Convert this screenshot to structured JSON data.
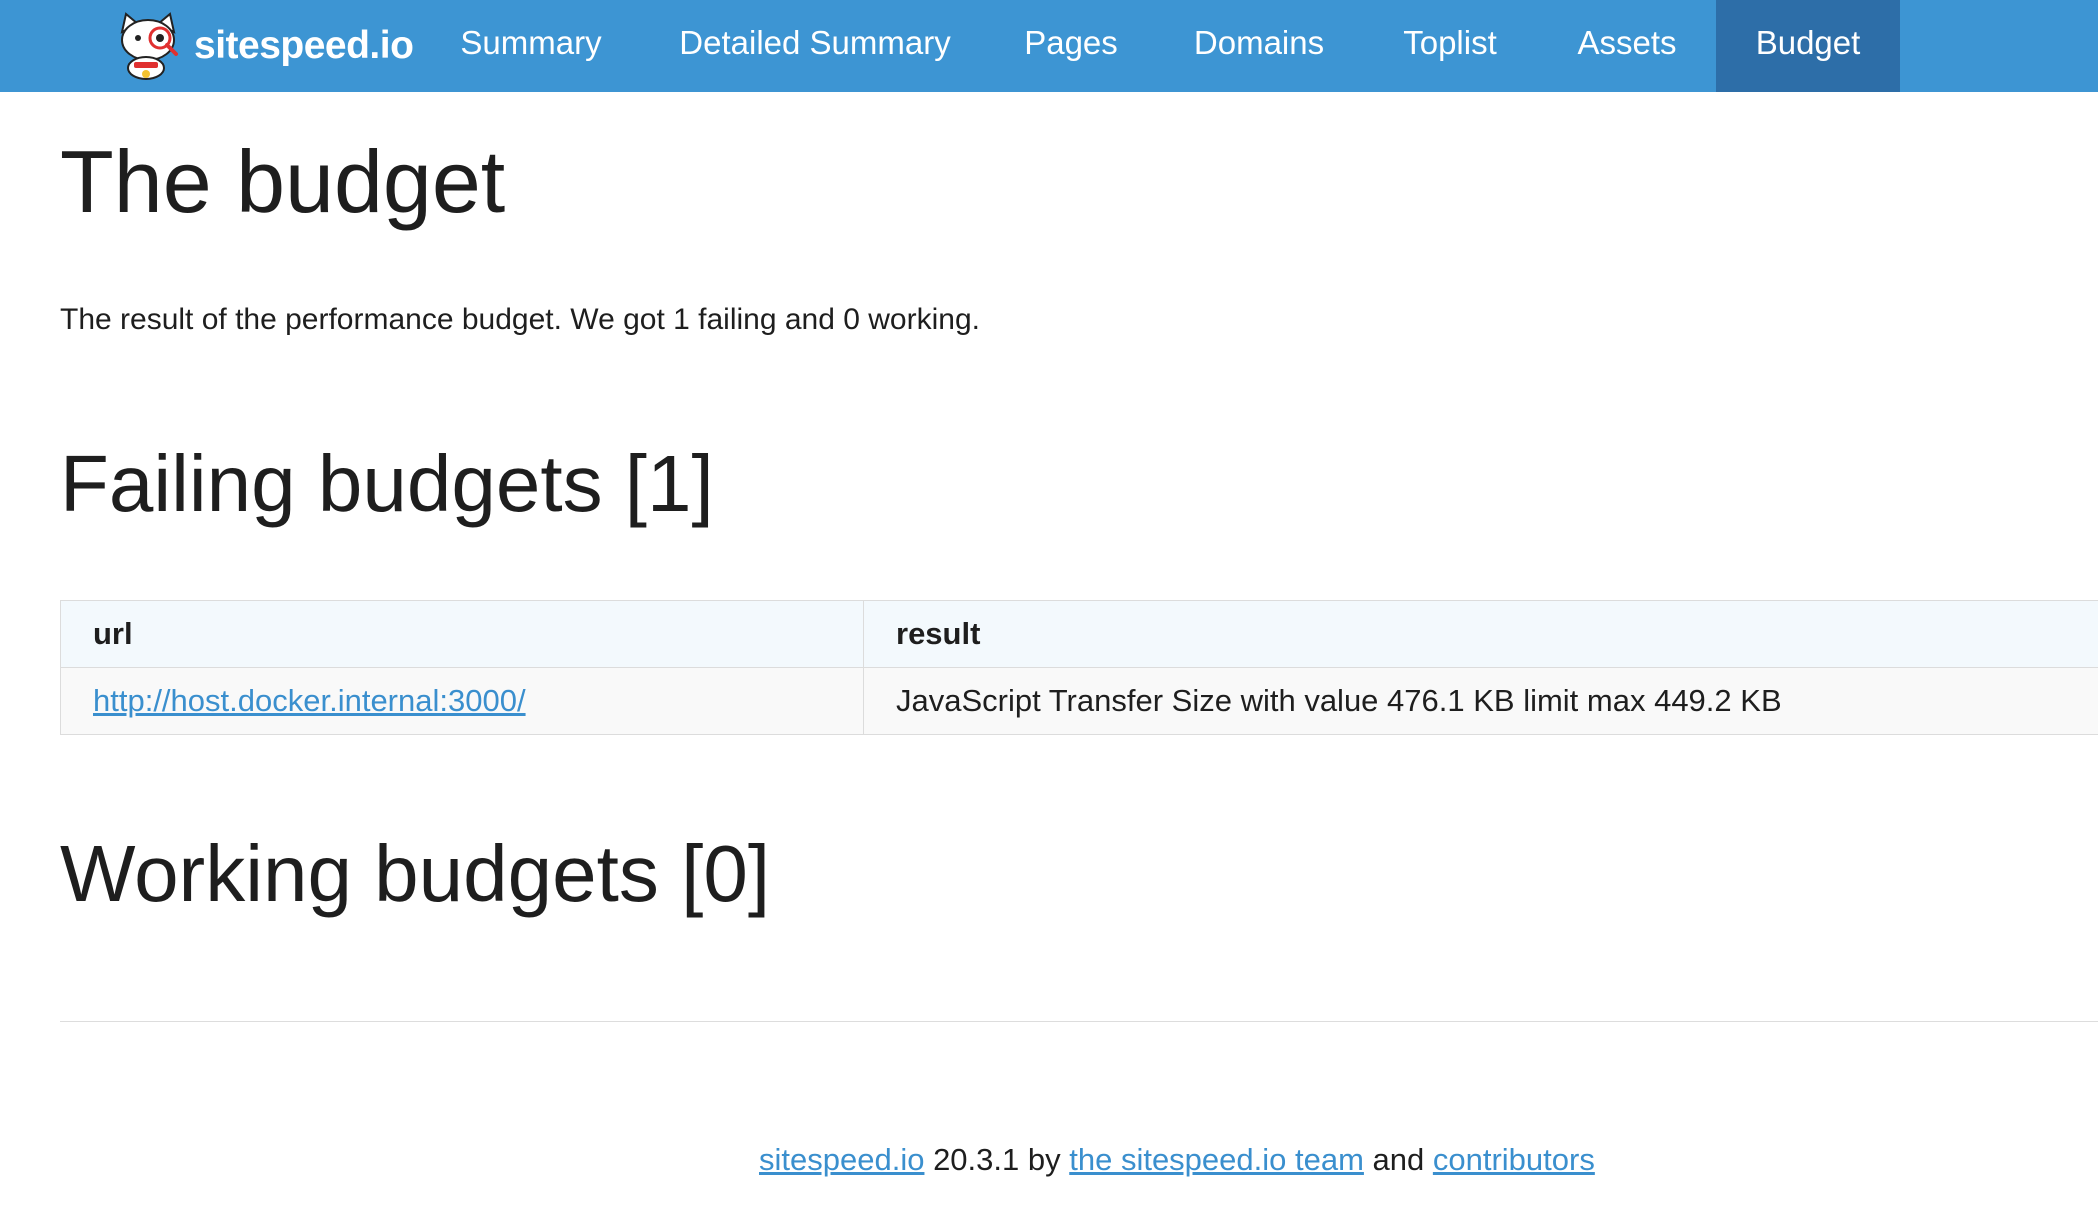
{
  "navbar": {
    "brand": "sitespeed.io",
    "logo_icon": "sitespeed-cat-logo-icon",
    "items": [
      {
        "label": "Summary",
        "active": false
      },
      {
        "label": "Detailed Summary",
        "active": false
      },
      {
        "label": "Pages",
        "active": false
      },
      {
        "label": "Domains",
        "active": false
      },
      {
        "label": "Toplist",
        "active": false
      },
      {
        "label": "Assets",
        "active": false
      },
      {
        "label": "Budget",
        "active": true
      }
    ],
    "colors": {
      "bar": "#3d95d3",
      "active": "#2d6ea8",
      "text": "#ffffff"
    }
  },
  "page": {
    "title": "The budget",
    "lead": "The result of the performance budget. We got 1 failing and 0 working."
  },
  "failing": {
    "heading": "Failing budgets [1]",
    "columns": [
      "url",
      "result"
    ],
    "rows": [
      {
        "url": "http://host.docker.internal:3000/",
        "result": "JavaScript Transfer Size with value 476.1 KB limit max 449.2 KB"
      }
    ]
  },
  "working": {
    "heading": "Working budgets [0]"
  },
  "footer": {
    "project_link": "sitespeed.io",
    "version_text": " 20.3.1 by ",
    "team_link": "the sitespeed.io team",
    "and_text": " and ",
    "contributors_link": "contributors",
    "link_color": "#3a8fce"
  }
}
